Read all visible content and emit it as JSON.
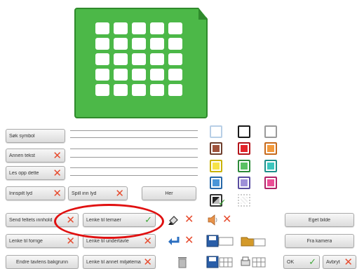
{
  "preview": {
    "icon": "symbol-grid-icon",
    "accent": "#4cb848"
  },
  "left_buttons": {
    "search_symbol": "Søk symbol",
    "other_text": "Annen tekst",
    "read_aloud": "Les opp dette",
    "recorded_sound": "Innspilt lyd",
    "play_sound": "Spill inn lyd",
    "here": "Her",
    "send_field_content": "Send feltets innhold",
    "link_to_topic": "Lenke til temaer",
    "link_to_previous": "Lenke til forrige",
    "link_to_subboard": "Lenke til undertavle",
    "change_background": "Endre tavlens bakgrunn",
    "link_to_other_environment": "Lenke til annet miljøtema"
  },
  "right_buttons": {
    "own_image": "Eget bilde",
    "from_camera": "Fra kamera",
    "ok": "OK",
    "cancel": "Avbryt"
  },
  "swatches": [
    {
      "name": "swatch-light-blue",
      "border": "#b8cfe6",
      "fill": "#ffffff"
    },
    {
      "name": "swatch-black",
      "border": "#1a1a1a",
      "fill": "#ffffff"
    },
    {
      "name": "swatch-gray",
      "border": "#9a9a9a",
      "fill": "#ffffff"
    },
    {
      "name": "swatch-brown",
      "border": "#6e3f2e",
      "fill": "#a0533c"
    },
    {
      "name": "swatch-red",
      "border": "#b3141a",
      "fill": "#e3252b"
    },
    {
      "name": "swatch-orange",
      "border": "#c76a1c",
      "fill": "#f39a3c"
    },
    {
      "name": "swatch-yellow",
      "border": "#c9b300",
      "fill": "#f6e34a"
    },
    {
      "name": "swatch-green",
      "border": "#2d8a3a",
      "fill": "#59c163"
    },
    {
      "name": "swatch-teal",
      "border": "#1d8f8a",
      "fill": "#3bc6be"
    },
    {
      "name": "swatch-blue",
      "border": "#2768a8",
      "fill": "#4a95d8"
    },
    {
      "name": "swatch-purple",
      "border": "#5a4ea0",
      "fill": "#9d90d8"
    },
    {
      "name": "swatch-pink",
      "border": "#b02268",
      "fill": "#ea4d95"
    },
    {
      "name": "swatch-gradient-selected",
      "border": "#333333",
      "fill": "#777777"
    },
    {
      "name": "swatch-transparent",
      "border": "#cccccc",
      "fill": "#f2f2f2"
    }
  ],
  "colors": {
    "delete": "#e74c2f",
    "confirm": "#43a83c",
    "highlight": "#e01010"
  }
}
